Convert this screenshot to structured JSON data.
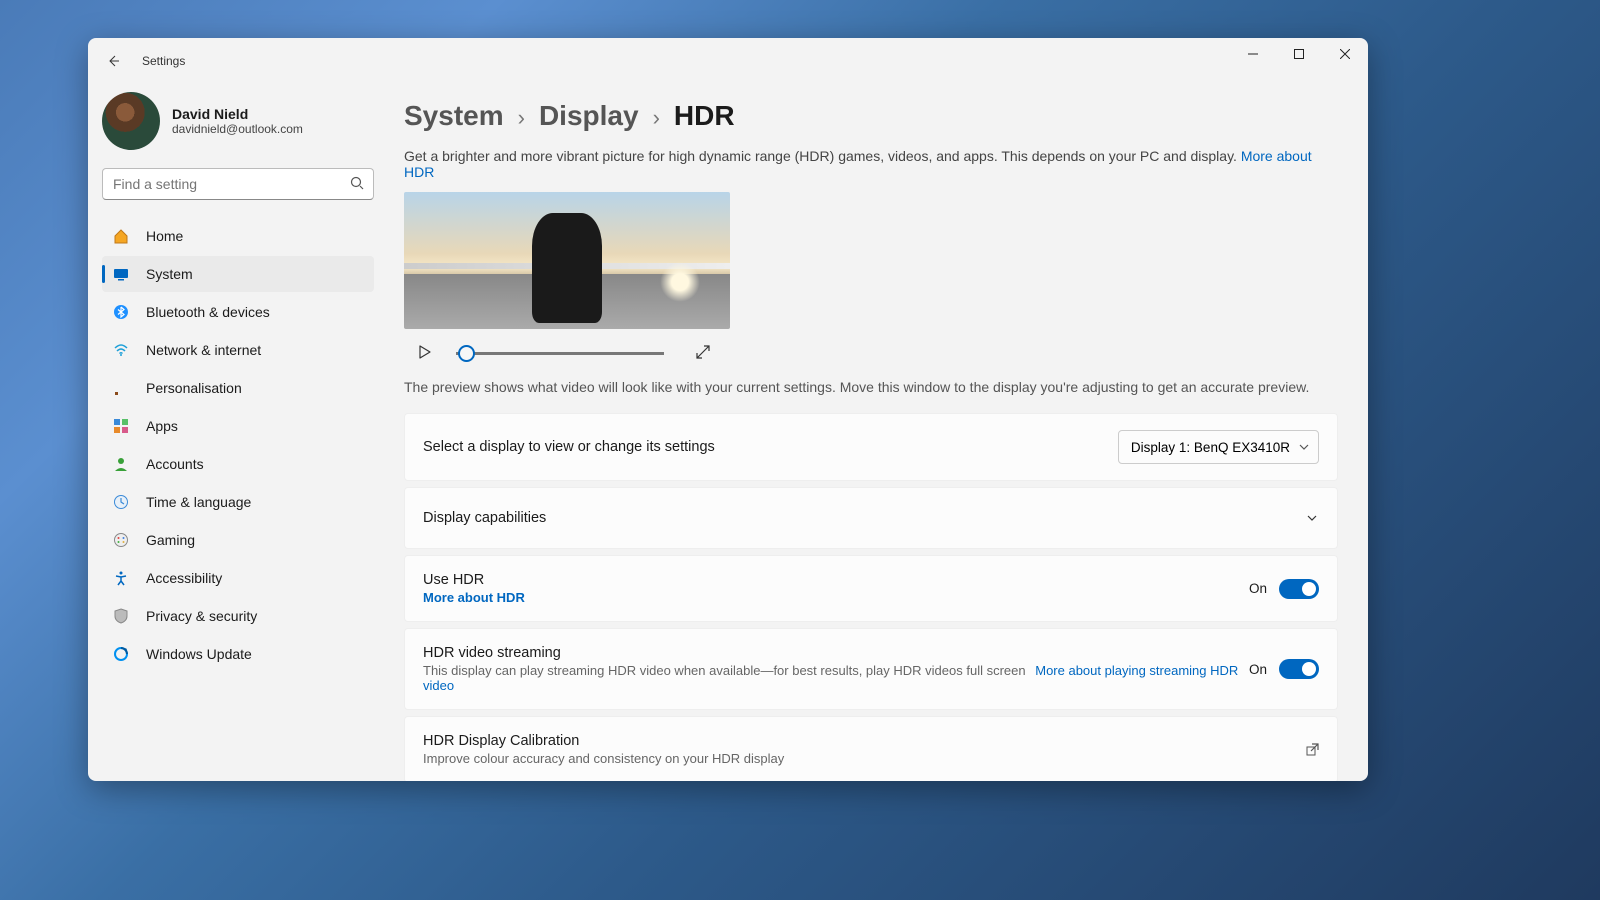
{
  "app_title": "Settings",
  "user": {
    "name": "David Nield",
    "email": "davidnield@outlook.com"
  },
  "search": {
    "placeholder": "Find a setting"
  },
  "nav": [
    {
      "label": "Home"
    },
    {
      "label": "System"
    },
    {
      "label": "Bluetooth & devices"
    },
    {
      "label": "Network & internet"
    },
    {
      "label": "Personalisation"
    },
    {
      "label": "Apps"
    },
    {
      "label": "Accounts"
    },
    {
      "label": "Time & language"
    },
    {
      "label": "Gaming"
    },
    {
      "label": "Accessibility"
    },
    {
      "label": "Privacy & security"
    },
    {
      "label": "Windows Update"
    }
  ],
  "breadcrumbs": {
    "a": "System",
    "b": "Display",
    "c": "HDR"
  },
  "intro": {
    "text": "Get a brighter and more vibrant picture for high dynamic range (HDR) games, videos, and apps. This depends on your PC and display.",
    "link": "More about HDR"
  },
  "preview_note": "The preview shows what video will look like with your current settings. Move this window to the display you're adjusting to get an accurate preview.",
  "display_select": {
    "label": "Select a display to view or change its settings",
    "value": "Display 1: BenQ EX3410R"
  },
  "capabilities": {
    "title": "Display capabilities"
  },
  "use_hdr": {
    "title": "Use HDR",
    "link": "More about HDR",
    "state": "On"
  },
  "streaming": {
    "title": "HDR video streaming",
    "sub": "This display can play streaming HDR video when available—for best results, play HDR videos full screen",
    "link": "More about playing streaming HDR video",
    "state": "On"
  },
  "calibration": {
    "title": "HDR Display Calibration",
    "sub": "Improve colour accuracy and consistency on your HDR display"
  }
}
